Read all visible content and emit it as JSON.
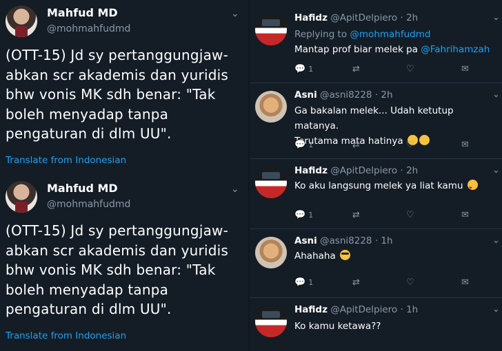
{
  "left_tweets": [
    {
      "name": "Mahfud MD",
      "handle": "@mohmahfudmd",
      "text": "(OTT-15) Jd sy pertanggungjaw-abkan scr akademis dan yuridis bhw vonis MK sdh benar: \"Tak boleh menyadap tanpa pengaturan di dlm UU\".",
      "translate": "Translate from Indonesian"
    },
    {
      "name": "Mahfud MD",
      "handle": "@mohmahfudmd",
      "text": "(OTT-15) Jd sy pertanggungjaw-abkan scr akademis dan yuridis bhw vonis MK sdh benar: \"Tak boleh menyadap tanpa pengaturan di dlm UU\".",
      "translate": "Translate from Indonesian"
    }
  ],
  "replies": [
    {
      "name": "Hafidz",
      "handle": "@ApitDelpiero",
      "time": "2h",
      "replying_prefix": "Replying to ",
      "replying_to": "@mohmahfudmd",
      "text_before": "Mantap prof biar melek pa ",
      "mention": "@Fahrihamzah",
      "reply_count": "1"
    },
    {
      "name": "Asni",
      "handle": "@asni8228",
      "time": "2h",
      "line1": "Ga bakalan melek... Udah ketutup matanya.",
      "line2": "Terutama mata hatinya",
      "reply_count": "1"
    },
    {
      "name": "Hafidz",
      "handle": "@ApitDelpiero",
      "time": "2h",
      "text": "Ko aku langsung melek ya liat kamu",
      "reply_count": "1"
    },
    {
      "name": "Asni",
      "handle": "@asni8228",
      "time": "1h",
      "text": "Ahahaha",
      "reply_count": "1"
    },
    {
      "name": "Hafidz",
      "handle": "@ApitDelpiero",
      "time": "1h",
      "text": "Ko kamu ketawa??"
    }
  ],
  "icons": {
    "reply": "reply-icon",
    "retweet": "retweet-icon",
    "like": "heart-icon",
    "dm": "envelope-icon",
    "more": "chevron-down-icon"
  },
  "colors": {
    "background": "#141d26",
    "link": "#1da1f2",
    "muted": "#8899a6"
  }
}
